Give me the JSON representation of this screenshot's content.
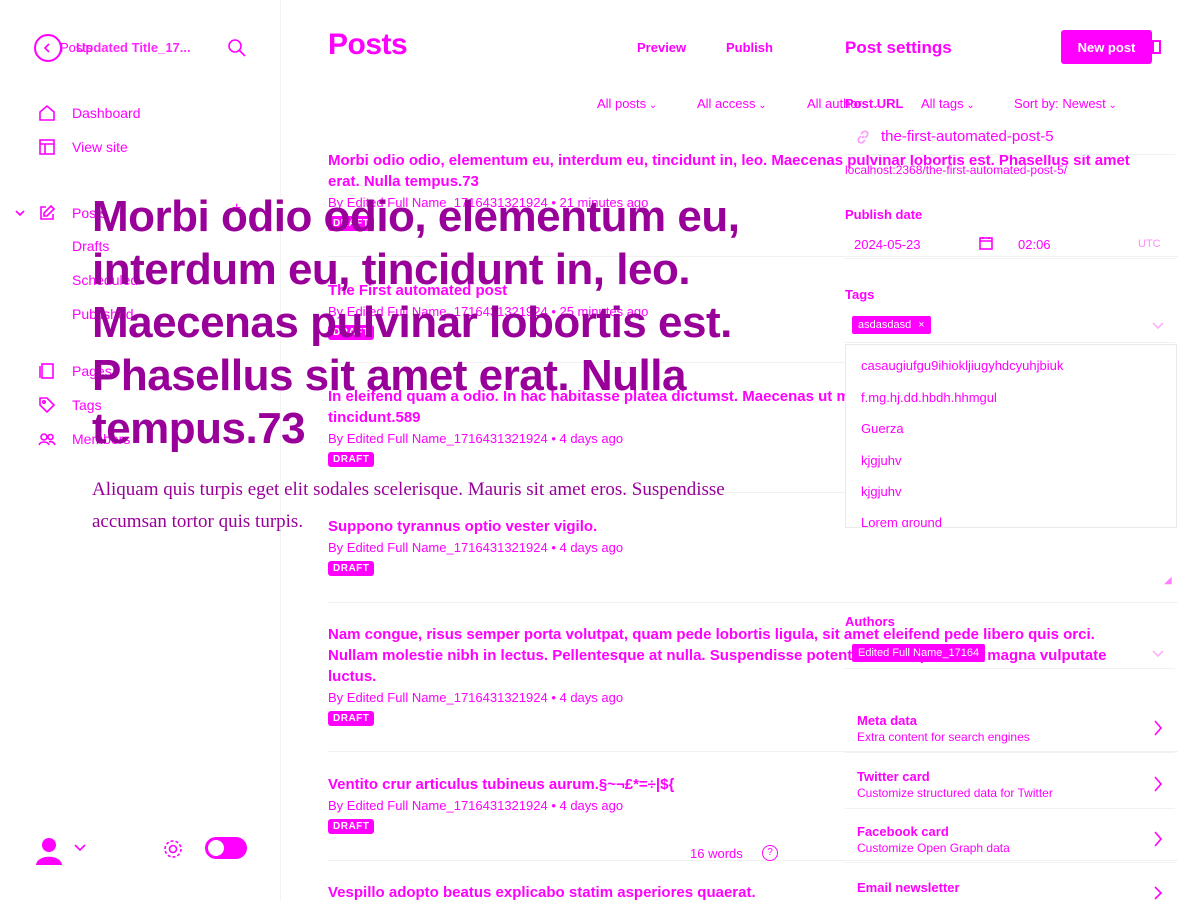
{
  "theme": {
    "accent": "#ff00ff",
    "overlay_text": "#990099"
  },
  "sidebar": {
    "back_label": "Posts",
    "post_title_ghost": "Updated Title_17...",
    "nav": {
      "dashboard": "Dashboard",
      "view_site": "View site",
      "posts": "Posts",
      "drafts": "Drafts",
      "scheduled": "Scheduled",
      "published": "Published",
      "pages": "Pages",
      "tags": "Tags",
      "members": "Members"
    }
  },
  "header": {
    "title": "Posts",
    "preview": "Preview",
    "publish": "Publish",
    "settings_title": "Post settings",
    "new_post": "New post"
  },
  "filters": {
    "all_posts": "All posts",
    "all_access": "All access",
    "all_authors": "All authors",
    "all_tags": "All tags",
    "sort": "Sort by: Newest"
  },
  "posts": [
    {
      "title": "Morbi odio odio, elementum eu, interdum eu, tincidunt in, leo. Maecenas pulvinar lobortis est. Phasellus sit amet erat. Nulla tempus.73",
      "meta": "By Edited Full Name_1716431321924 • 21 minutes ago",
      "status": "DRAFT"
    },
    {
      "title": "The First automated post",
      "meta": "By Edited Full Name_1716431321924 • 25 minutes ago",
      "status": "DRAFT"
    },
    {
      "title": "In eleifend quam a odio. In hac habitasse platea dictumst. Maecenas ut massa quis augue luctus tincidunt.589",
      "meta": "By Edited Full Name_1716431321924 • 4 days ago",
      "status": "DRAFT"
    },
    {
      "title": "Suppono tyrannus optio vester vigilo.",
      "meta": "By Edited Full Name_1716431321924 • 4 days ago",
      "status": "DRAFT"
    },
    {
      "title": "Nam congue, risus semper porta volutpat, quam pede lobortis ligula, sit amet eleifend pede libero quis orci. Nullam molestie nibh in lectus. Pellentesque at nulla. Suspendisse potenti. Cras in purus eu magna vulputate luctus.",
      "meta": "By Edited Full Name_1716431321924 • 4 days ago",
      "status": "DRAFT"
    },
    {
      "title": "Ventito crur articulus tubineus aurum.§~¬£*=÷|${",
      "meta": "By Edited Full Name_1716431321924 • 4 days ago",
      "status": "DRAFT"
    },
    {
      "title": "Vespillo adopto beatus explicabo statim asperiores quaerat."
    }
  ],
  "editor": {
    "title": "Morbi odio odio, elementum eu, interdum eu, tincidunt in, leo. Maecenas pulvinar lobortis est. Phasellus sit amet erat. Nulla tempus.73",
    "body": "Aliquam quis turpis eget elit sodales scelerisque. Mauris sit amet eros. Suspendisse accumsan tortor quis turpis.",
    "word_count": "16 words"
  },
  "settings": {
    "post_url_label": "Post URL",
    "post_url_value": "the-first-automated-post-5",
    "post_url_full": "localhost:2368/the-first-automated-post-5/",
    "publish_date_label": "Publish date",
    "date": "2024-05-23",
    "time": "02:06",
    "timezone": "UTC",
    "tags_label": "Tags",
    "selected_tag": "asdasdasd",
    "tag_options": [
      "casaugiufgu9ihiokljiugyhdcyuhjbiuk",
      "f.mg.hj.dd.hbdh.hhmgul",
      "Guerza",
      "kjgjuhv",
      "kjgjuhv",
      "Lorem ground"
    ],
    "authors_label": "Authors",
    "author": "Edited Full Name_17164",
    "rows": [
      {
        "title": "Meta data",
        "sub": "Extra content for search engines"
      },
      {
        "title": "Twitter card",
        "sub": "Customize structured data for Twitter"
      },
      {
        "title": "Facebook card",
        "sub": "Customize Open Graph data"
      },
      {
        "title": "Email newsletter",
        "sub": ""
      }
    ]
  }
}
